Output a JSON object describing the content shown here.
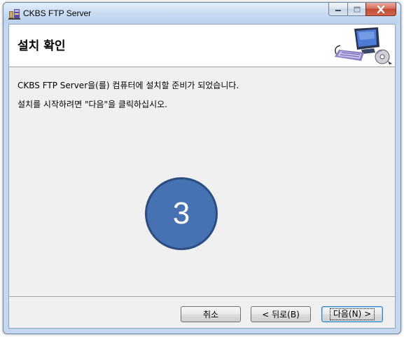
{
  "window": {
    "title": "CKBS FTP Server"
  },
  "banner": {
    "title": "설치 확인"
  },
  "body": {
    "message1": "CKBS FTP Server을(를) 컴퓨터에 설치할 준비가 되었습니다.",
    "message2": "설치를 시작하려면 \"다음\"을 클릭하십시오.",
    "step_number": "3"
  },
  "buttons": {
    "cancel": "취소",
    "back": "< 뒤로(B)",
    "next": "다음(N) >"
  },
  "colors": {
    "title_bar": "#c9dcf1",
    "client_bg": "#f0f0f0",
    "close_button": "#c24a33",
    "step_circle": "#4672b4"
  },
  "icons": {
    "app": "installer-icon",
    "banner": "computer-disc-icon"
  }
}
